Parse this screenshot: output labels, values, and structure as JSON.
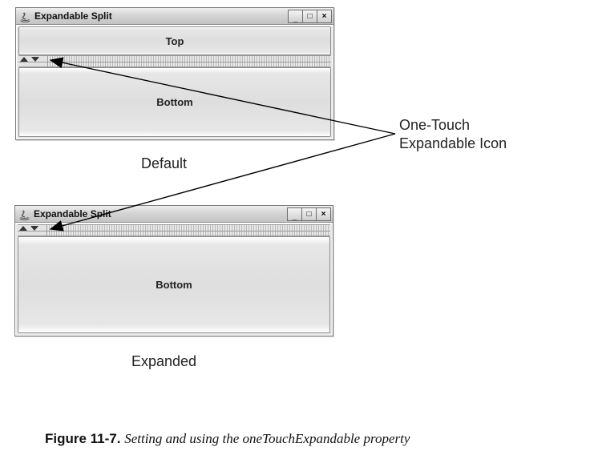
{
  "windows": {
    "default": {
      "title": "Expandable Split",
      "top_label": "Top",
      "bottom_label": "Bottom",
      "caption": "Default"
    },
    "expanded": {
      "title": "Expandable Split",
      "bottom_label": "Bottom",
      "caption": "Expanded"
    }
  },
  "winbuttons": {
    "minimize": "−",
    "maximize": "□",
    "close": "×"
  },
  "callout": {
    "line1": "One-Touch",
    "line2": "Expandable Icon"
  },
  "figure": {
    "label": "Figure 11-7.",
    "desc": "Setting and using the oneTouchExpandable property"
  }
}
